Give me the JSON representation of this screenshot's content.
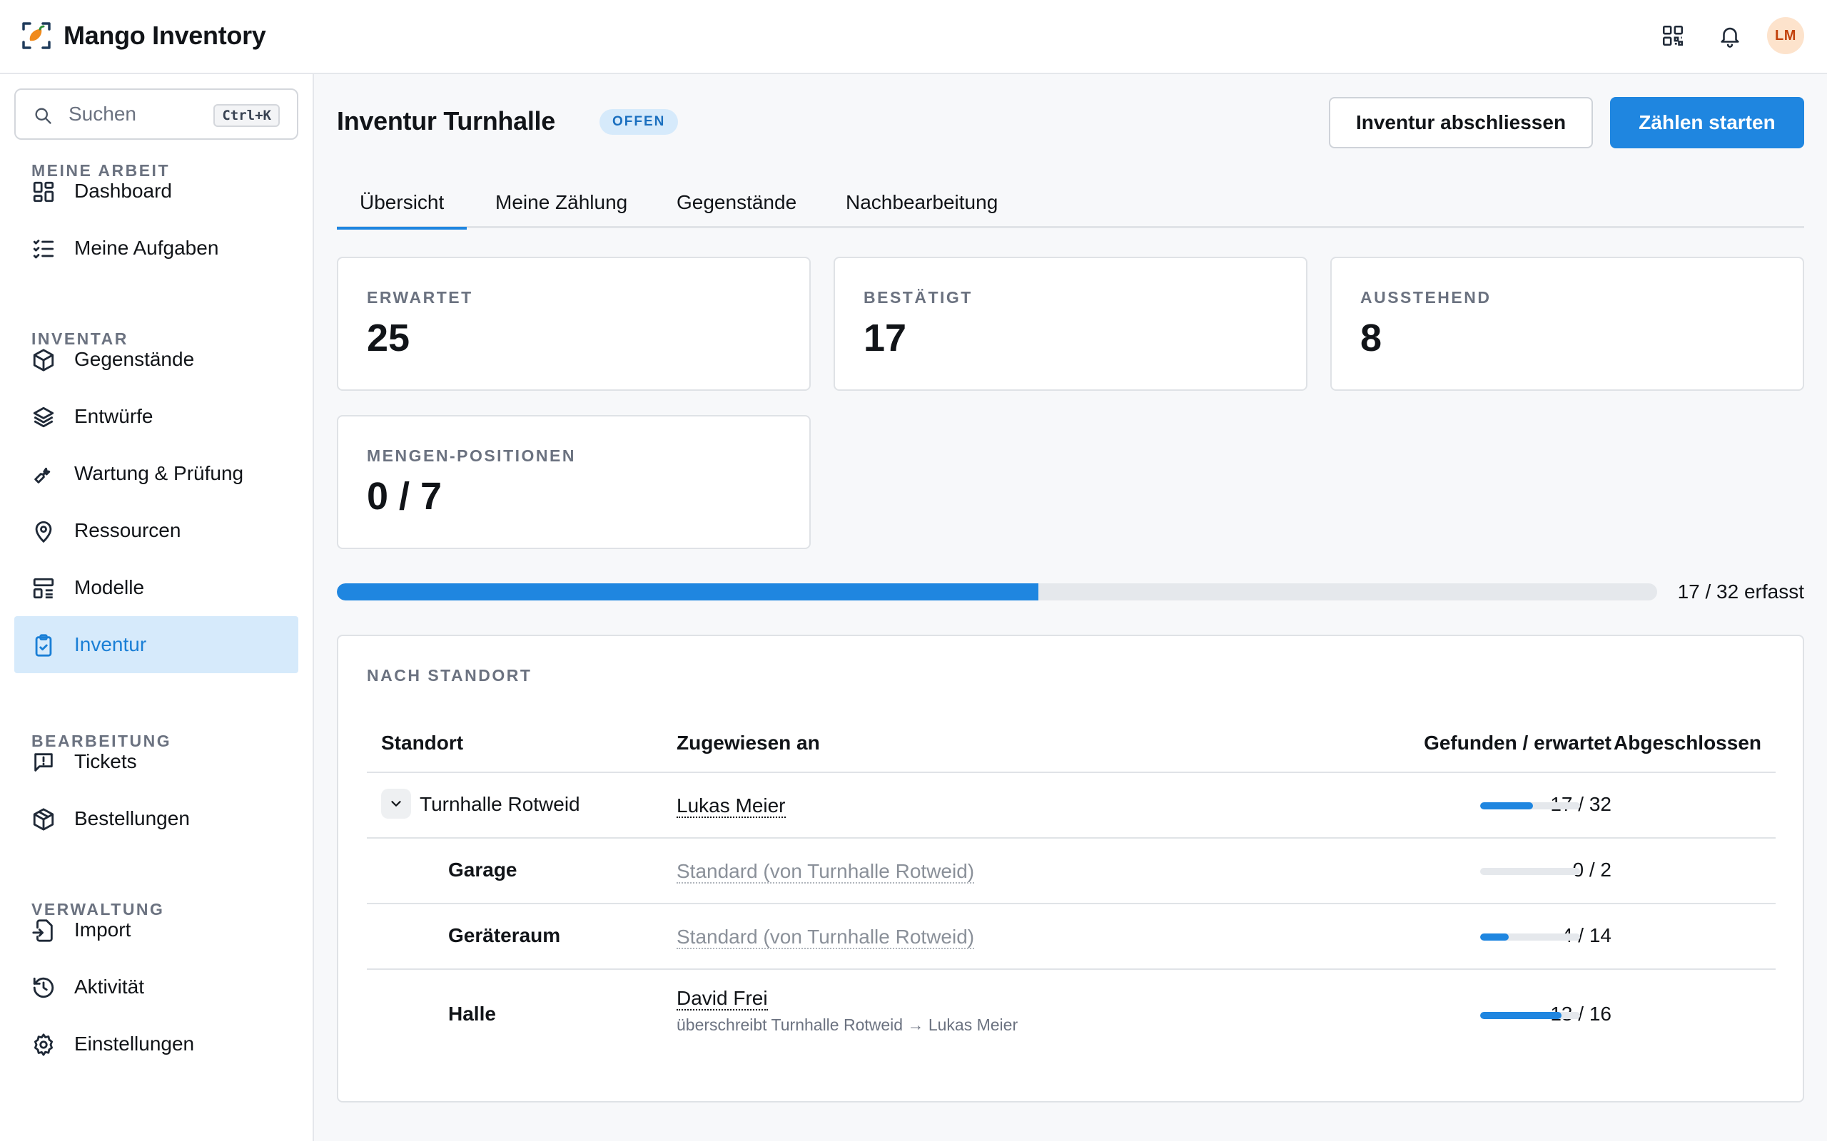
{
  "app": {
    "title": "Mango Inventory"
  },
  "header": {
    "avatar_initials": "LM"
  },
  "search": {
    "placeholder": "Suchen",
    "shortcut": "Ctrl+K"
  },
  "sidebar": {
    "sections": [
      {
        "label": "MEINE ARBEIT"
      },
      {
        "label": "INVENTAR"
      },
      {
        "label": "BEARBEITUNG"
      },
      {
        "label": "VERWALTUNG"
      }
    ],
    "items": [
      {
        "label": "Dashboard",
        "icon": "dashboard-icon"
      },
      {
        "label": "Meine Aufgaben",
        "icon": "task-list-icon"
      },
      {
        "label": "Gegenstände",
        "icon": "box-icon"
      },
      {
        "label": "Entwürfe",
        "icon": "layers-icon"
      },
      {
        "label": "Wartung & Prüfung",
        "icon": "wrench-icon"
      },
      {
        "label": "Ressourcen",
        "icon": "map-pin-icon"
      },
      {
        "label": "Modelle",
        "icon": "models-icon"
      },
      {
        "label": "Inventur",
        "icon": "clipboard-check-icon",
        "active": true
      },
      {
        "label": "Tickets",
        "icon": "message-alert-icon"
      },
      {
        "label": "Bestellungen",
        "icon": "package-icon"
      },
      {
        "label": "Import",
        "icon": "file-import-icon"
      },
      {
        "label": "Aktivität",
        "icon": "history-icon"
      },
      {
        "label": "Einstellungen",
        "icon": "gear-icon"
      }
    ]
  },
  "main": {
    "title": "Inventur Turnhalle",
    "status": "OFFEN",
    "actions": {
      "close_label": "Inventur abschliessen",
      "start_label": "Zählen starten"
    },
    "tabs": [
      {
        "label": "Übersicht",
        "active": true
      },
      {
        "label": "Meine Zählung"
      },
      {
        "label": "Gegenstände"
      },
      {
        "label": "Nachbearbeitung"
      }
    ],
    "stats": [
      {
        "label": "ERWARTET",
        "value": "25"
      },
      {
        "label": "BESTÄTIGT",
        "value": "17"
      },
      {
        "label": "AUSSTEHEND",
        "value": "8"
      },
      {
        "label": "MENGEN-POSITIONEN",
        "value": "0 / 7"
      }
    ],
    "progress": {
      "found": 17,
      "expected": 32,
      "text": "17 / 32 erfasst"
    }
  },
  "locations": {
    "section_label": "NACH STANDORT",
    "columns": {
      "location": "Standort",
      "assigned": "Zugewiesen an",
      "found": "Gefunden / erwartet",
      "done": "Abgeschlossen"
    },
    "rows": [
      {
        "location": "Turnhalle Rotweid",
        "assigned": "Lukas Meier",
        "note": "",
        "found_text": "17 / 32",
        "found": 17,
        "expected": 32
      },
      {
        "location": "Garage",
        "assigned": "Standard (von Turnhalle Rotweid)",
        "note": "",
        "found_text": "0 / 2",
        "found": 0,
        "expected": 2
      },
      {
        "location": "Geräteraum",
        "assigned": "Standard (von Turnhalle Rotweid)",
        "note": "",
        "found_text": "4 / 14",
        "found": 4,
        "expected": 14
      },
      {
        "location": "Halle",
        "assigned": "David Frei",
        "note": "überschreibt Turnhalle Rotweid → Lukas Meier",
        "found_text": "13 / 16",
        "found": 13,
        "expected": 16
      }
    ]
  },
  "colors": {
    "accent": "#1f86e0",
    "active_nav_bg": "#d6eafb",
    "avatar_bg": "#fde3cc",
    "logo_orange": "#f08a1c"
  }
}
